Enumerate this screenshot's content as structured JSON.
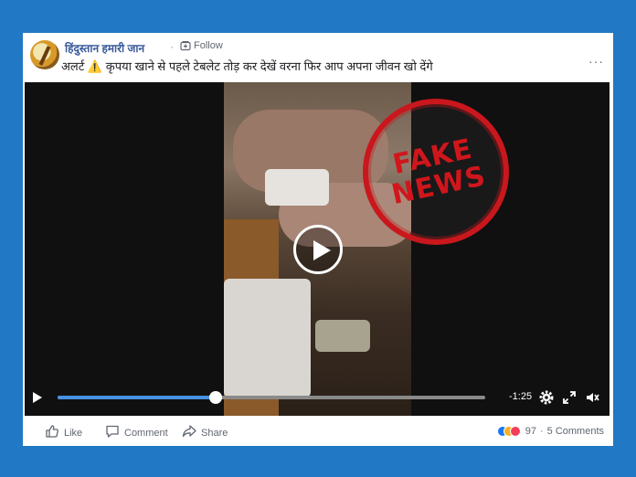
{
  "post": {
    "page_name": "हिंदुस्तान हमारी जान",
    "separator": "·",
    "follow_label": "Follow",
    "text": "अलर्ट ⚠️ कृपया खाने से पहले टेबलेट तोड़ कर देखें वरना फिर आप अपना जीवन खो देंगे",
    "more_label": "···"
  },
  "video": {
    "stamp_line1": "FAKE",
    "stamp_line2": "NEWS",
    "remaining_time": "-1:25",
    "progress": 0.37
  },
  "actions": {
    "like_label": "Like",
    "comment_label": "Comment",
    "share_label": "Share",
    "reaction_count": "97",
    "comments_count": "5 Comments",
    "dot": "·"
  },
  "icons": [
    "avatar",
    "follow-icon",
    "more-icon",
    "play-icon",
    "settings-icon",
    "fullscreen-icon",
    "volume-icon",
    "like-icon",
    "comment-icon",
    "share-icon",
    "reaction-like-icon",
    "reaction-haha-icon",
    "reaction-love-icon"
  ],
  "colors": {
    "background": "#2178c4",
    "link": "#385898",
    "accent": "#4a90e2",
    "stamp": "#d0161c"
  }
}
